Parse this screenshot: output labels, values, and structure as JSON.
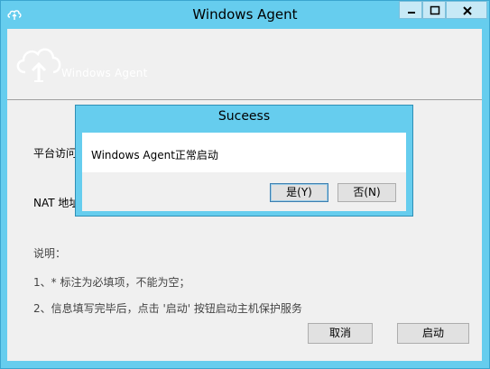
{
  "window": {
    "title": "Windows Agent"
  },
  "logo": {
    "text": "Windows Agent"
  },
  "form": {
    "platform_label": "平台访问",
    "nat_label": "NAT 地址"
  },
  "notes": {
    "heading": "说明：",
    "line1": "1、* 标注为必填项，不能为空；",
    "line2": "2、信息填写完毕后，点击 '启动' 按钮启动主机保护服务"
  },
  "buttons": {
    "cancel": "取消",
    "start": "启动"
  },
  "dialog": {
    "title": "Suceess",
    "message": "Windows Agent正常启动",
    "yes": "是(Y)",
    "no": "否(N)"
  },
  "colors": {
    "accent": "#66cdee",
    "client_bg": "#f0f0f0"
  }
}
